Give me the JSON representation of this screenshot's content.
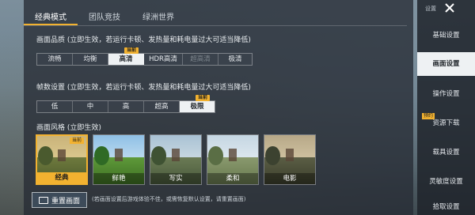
{
  "tabs": [
    {
      "label": "经典模式",
      "active": true
    },
    {
      "label": "团队竞技",
      "active": false
    },
    {
      "label": "绿洲世界",
      "active": false
    }
  ],
  "quality": {
    "title": "画面品质 (立即生效，若运行卡顿、发热量和耗电量过大可适当降低)",
    "badge": "当前",
    "options": [
      {
        "label": "流畅",
        "state": "normal"
      },
      {
        "label": "均衡",
        "state": "normal"
      },
      {
        "label": "高清",
        "state": "selected"
      },
      {
        "label": "HDR高清",
        "state": "normal"
      },
      {
        "label": "超高清",
        "state": "disabled"
      },
      {
        "label": "极清",
        "state": "normal"
      }
    ]
  },
  "framerate": {
    "title": "帧数设置 (立即生效，若运行卡顿、发热量和耗电量过大可适当降低)",
    "badge": "当前",
    "options": [
      {
        "label": "低",
        "state": "normal"
      },
      {
        "label": "中",
        "state": "normal"
      },
      {
        "label": "高",
        "state": "normal"
      },
      {
        "label": "超高",
        "state": "normal"
      },
      {
        "label": "极限",
        "state": "selected"
      }
    ]
  },
  "style": {
    "title": "画面风格 (立即生效)",
    "badge": "当前",
    "cards": [
      {
        "label": "经典",
        "selected": true
      },
      {
        "label": "鲜艳",
        "selected": false
      },
      {
        "label": "写实",
        "selected": false
      },
      {
        "label": "柔和",
        "selected": false
      },
      {
        "label": "电影",
        "selected": false
      }
    ]
  },
  "reset": {
    "button_label": "重置画面",
    "note": "(若画面设置后游戏体验不佳，或需恢复默认设置，请重置画面)"
  },
  "sidebar": {
    "top_label": "设置",
    "items": [
      {
        "label": "基础设置",
        "active": false,
        "tag": ""
      },
      {
        "label": "画面设置",
        "active": true,
        "tag": ""
      },
      {
        "label": "操作设置",
        "active": false,
        "tag": ""
      },
      {
        "label": "资源下载",
        "active": false,
        "tag": "预约"
      },
      {
        "label": "载具设置",
        "active": false,
        "tag": ""
      },
      {
        "label": "灵敏度设置",
        "active": false,
        "tag": ""
      },
      {
        "label": "拾取设置",
        "active": false,
        "tag": ""
      }
    ]
  },
  "colors": {
    "accent": "#f2b230",
    "selected_bg": "#eef1f3",
    "panel": "#262c34"
  }
}
